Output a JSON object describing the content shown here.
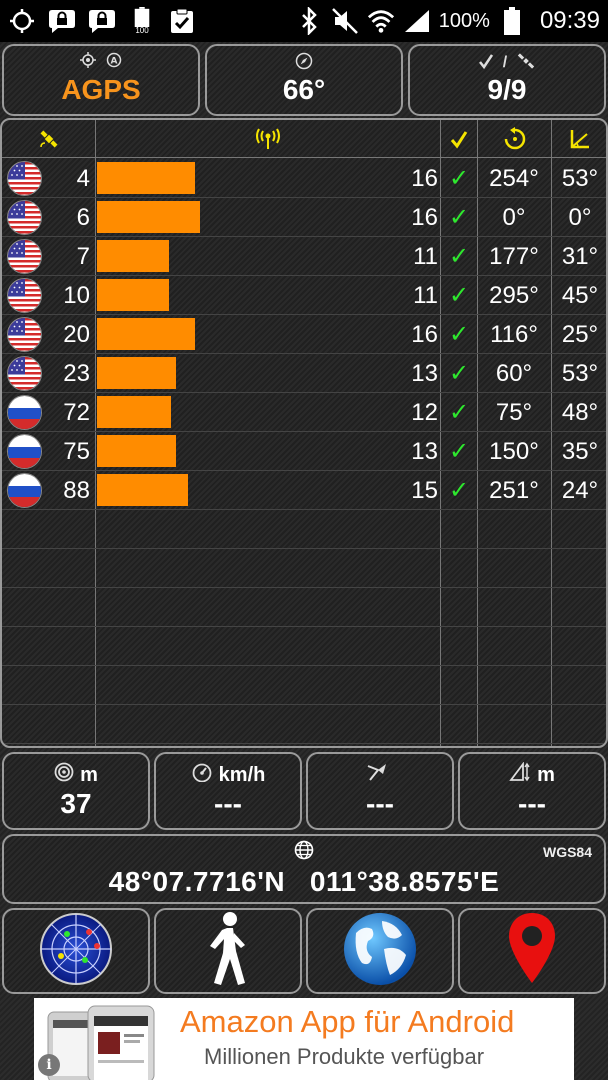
{
  "status_bar": {
    "battery_percent": "100%",
    "battery_small_label": "100",
    "time": "09:39",
    "icons_left": [
      "gps-icon",
      "lock-notification-icon",
      "lock-notification-icon",
      "battery-full-icon",
      "clipboard-check-icon"
    ],
    "icons_right": [
      "bluetooth-icon",
      "mute-icon",
      "wifi-icon",
      "signal-icon",
      "battery-icon"
    ]
  },
  "header": {
    "mode": {
      "value": "AGPS",
      "icons": [
        "gps-target-icon",
        "auto-icon"
      ]
    },
    "heading": {
      "value": "66°",
      "icon": "compass-icon"
    },
    "sats": {
      "value": "9/9",
      "icons": [
        "check-icon",
        "satellite-icon"
      ],
      "separator": "/"
    }
  },
  "table": {
    "headers": [
      "satellite-icon",
      "signal-icon",
      "check-icon",
      "azimuth-icon",
      "elevation-icon"
    ],
    "rows": [
      {
        "flag": "us",
        "prn": "4",
        "snr": "16",
        "used": "✓",
        "azimuth": "254°",
        "elevation": "53°",
        "bar": 0.41
      },
      {
        "flag": "us",
        "prn": "6",
        "snr": "16",
        "used": "✓",
        "azimuth": "0°",
        "elevation": "0°",
        "bar": 0.43
      },
      {
        "flag": "us",
        "prn": "7",
        "snr": "11",
        "used": "✓",
        "azimuth": "177°",
        "elevation": "31°",
        "bar": 0.3
      },
      {
        "flag": "us",
        "prn": "10",
        "snr": "11",
        "used": "✓",
        "azimuth": "295°",
        "elevation": "45°",
        "bar": 0.3
      },
      {
        "flag": "us",
        "prn": "20",
        "snr": "16",
        "used": "✓",
        "azimuth": "116°",
        "elevation": "25°",
        "bar": 0.41
      },
      {
        "flag": "us",
        "prn": "23",
        "snr": "13",
        "used": "✓",
        "azimuth": "60°",
        "elevation": "53°",
        "bar": 0.33
      },
      {
        "flag": "ru",
        "prn": "72",
        "snr": "12",
        "used": "✓",
        "azimuth": "75°",
        "elevation": "48°",
        "bar": 0.31
      },
      {
        "flag": "ru",
        "prn": "75",
        "snr": "13",
        "used": "✓",
        "azimuth": "150°",
        "elevation": "35°",
        "bar": 0.33
      },
      {
        "flag": "ru",
        "prn": "88",
        "snr": "15",
        "used": "✓",
        "azimuth": "251°",
        "elevation": "24°",
        "bar": 0.38
      }
    ],
    "empty_rows": 6
  },
  "stats": [
    {
      "icon": "accuracy-icon",
      "unit": "m",
      "value": "37"
    },
    {
      "icon": "speedometer-icon",
      "unit": "km/h",
      "value": "---"
    },
    {
      "icon": "bearing-icon",
      "unit": "",
      "value": "---"
    },
    {
      "icon": "altitude-icon",
      "unit": "m",
      "value": "---"
    }
  ],
  "coordinates": {
    "icon": "globe-icon",
    "datum": "WGS84",
    "value": "48°07.7716'N   011°38.8575'E"
  },
  "nav": [
    {
      "name": "radar-button",
      "icon": "radar-icon"
    },
    {
      "name": "walk-button",
      "icon": "pedestrian-icon"
    },
    {
      "name": "globe-button",
      "icon": "globe-icon"
    },
    {
      "name": "map-pin-button",
      "icon": "map-pin-icon"
    }
  ],
  "ad": {
    "title": "Amazon App für Android",
    "subtitle": "Millionen Produkte verfügbar",
    "info": "i"
  },
  "colors": {
    "bar": "#ff8c00",
    "check": "#2ee82e",
    "mode": "#f7941d",
    "header_icon": "#f5e400"
  }
}
